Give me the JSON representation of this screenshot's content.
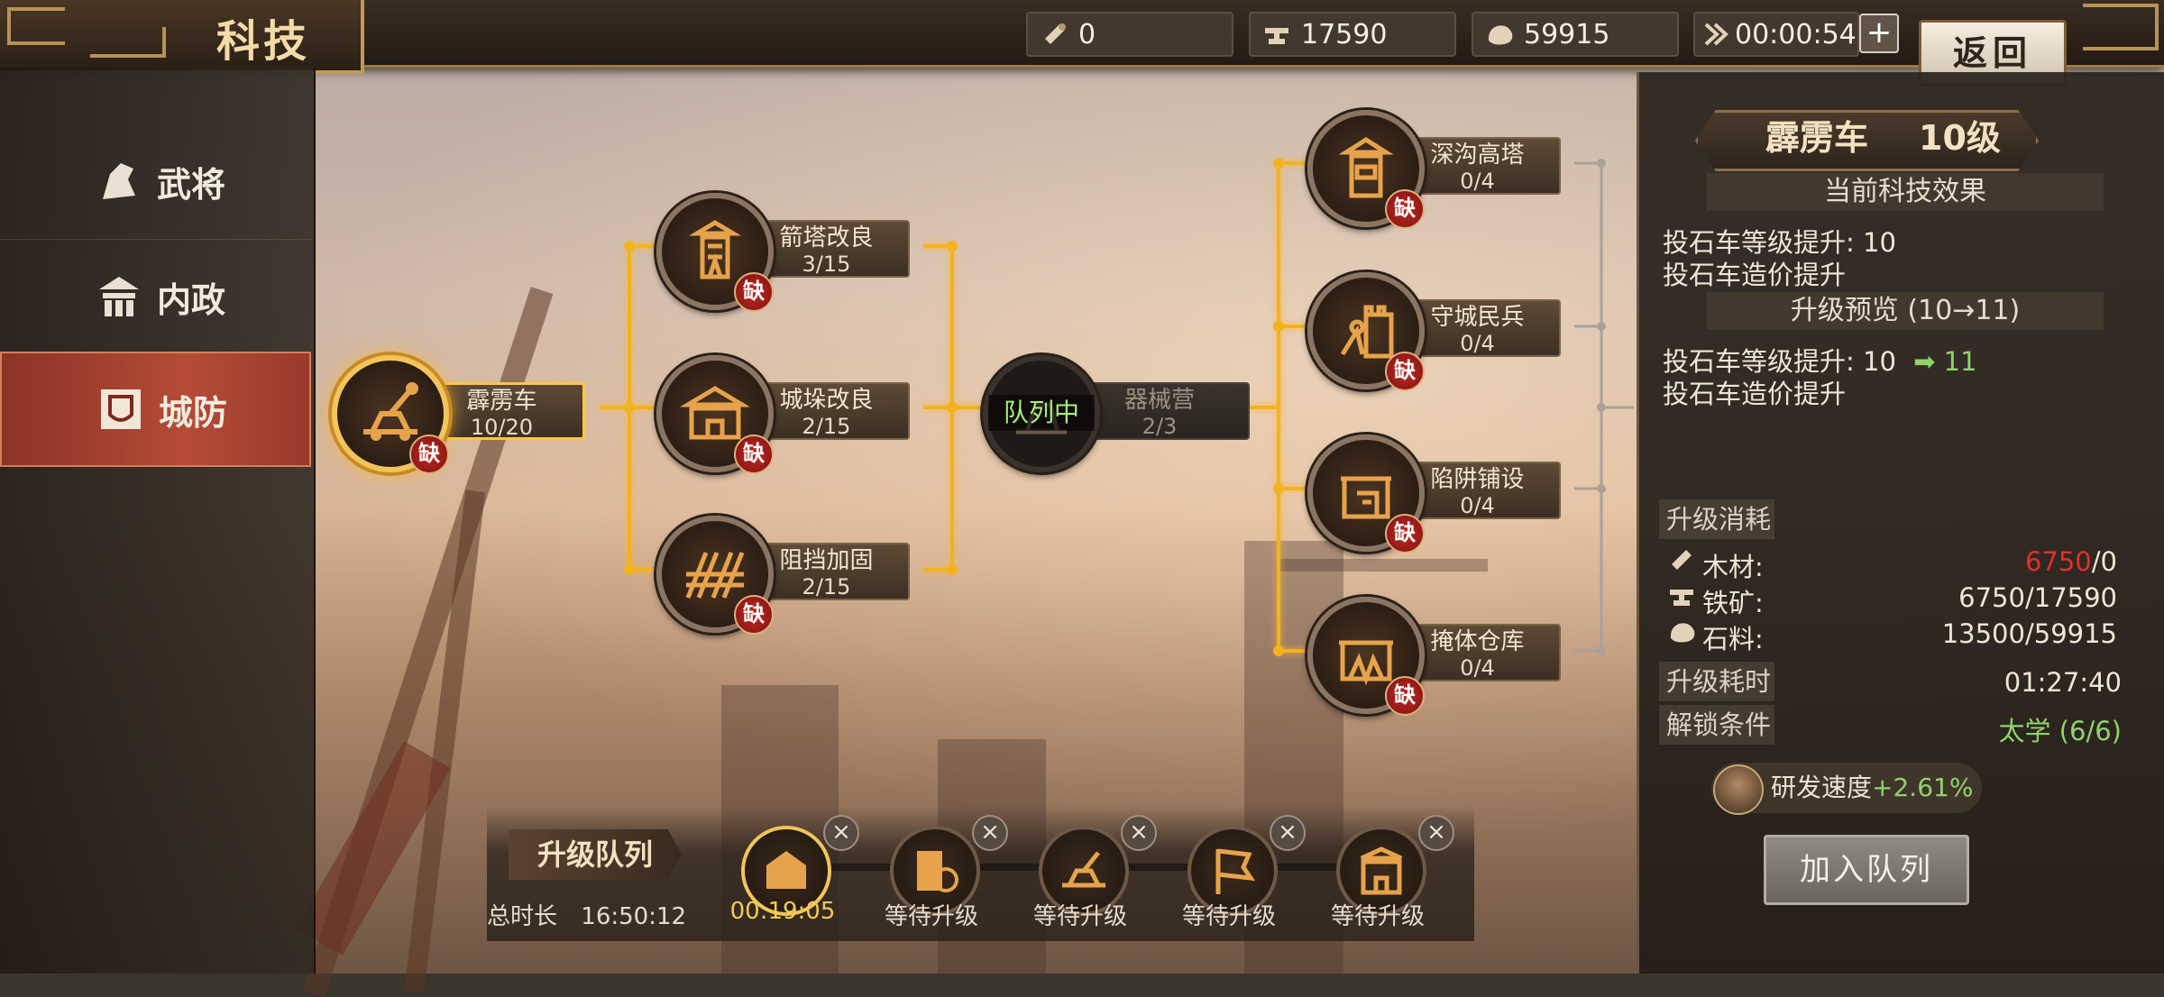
{
  "header": {
    "title": "科技",
    "back_label": "返回",
    "plus_label": "+",
    "resources": [
      {
        "icon": "wood-icon",
        "value": "0"
      },
      {
        "icon": "iron-icon",
        "value": "17590"
      },
      {
        "icon": "stone-icon",
        "value": "59915"
      },
      {
        "icon": "speedup-icon",
        "value": "00:00:54"
      }
    ]
  },
  "nav": {
    "items": [
      {
        "label": "武将",
        "icon": "general-icon",
        "active": false
      },
      {
        "label": "内政",
        "icon": "civil-icon",
        "active": false
      },
      {
        "label": "城防",
        "icon": "defense-icon",
        "active": true
      }
    ]
  },
  "tree": {
    "lack_label": "缺",
    "queue_tag": "队列中",
    "nodes": [
      {
        "name": "霹雳车",
        "level": "10/20",
        "icon": "catapult-icon",
        "selected": true,
        "lack": true
      },
      {
        "name": "箭塔改良",
        "level": "3/15",
        "icon": "arrow-tower-icon",
        "lack": true
      },
      {
        "name": "城垛改良",
        "level": "2/15",
        "icon": "battlement-icon",
        "lack": true
      },
      {
        "name": "阻挡加固",
        "level": "2/15",
        "icon": "barricade-icon",
        "lack": true
      },
      {
        "name": "器械营",
        "level": "2/3",
        "icon": "siege-camp-icon",
        "queued": true
      },
      {
        "name": "深沟高塔",
        "level": "0/4",
        "icon": "watchtower-icon",
        "lack": true
      },
      {
        "name": "守城民兵",
        "level": "0/4",
        "icon": "militia-icon",
        "lack": true
      },
      {
        "name": "陷阱铺设",
        "level": "0/4",
        "icon": "trap-icon",
        "lack": true
      },
      {
        "name": "掩体仓库",
        "level": "0/4",
        "icon": "bunker-icon",
        "lack": true
      }
    ]
  },
  "panel": {
    "title_name": "霹雳车",
    "title_level": "10级",
    "current_effect_header": "当前科技效果",
    "current_effects": [
      "投石车等级提升: 10",
      "投石车造价提升"
    ],
    "preview_header": "升级预览 (10→11)",
    "preview_line1_prefix": "投石车等级提升: 10",
    "preview_arrow": "➡",
    "preview_line1_next": "11",
    "preview_line2": "投石车造价提升",
    "cost_header": "升级消耗",
    "costs": [
      {
        "name": "木材:",
        "icon": "wood-icon",
        "need": "6750",
        "have": "/0",
        "insufficient": true
      },
      {
        "name": "铁矿:",
        "icon": "iron-icon",
        "need": "6750",
        "have": "/17590",
        "insufficient": false
      },
      {
        "name": "石料:",
        "icon": "stone-icon",
        "need": "13500",
        "have": "/59915",
        "insufficient": false
      }
    ],
    "time_label": "升级耗时",
    "time_value": "01:27:40",
    "unlock_label": "解锁条件",
    "unlock_value": "太学 (6/6)",
    "speed_label": "研发速度",
    "speed_value": "+2.61%",
    "join_label": "加入队列",
    "colors": {
      "insufficient": "#e0302a",
      "ok": "#8fd46a",
      "accent": "#f2c45a"
    }
  },
  "queue": {
    "label": "升级队列",
    "total_label": "总时长",
    "total_value": "16:50:12",
    "close_label": "×",
    "slots": [
      {
        "icon": "research-icon",
        "status": "00:19:05",
        "active": true
      },
      {
        "icon": "book-clock-icon",
        "status": "等待升级"
      },
      {
        "icon": "catapult-icon",
        "status": "等待升级"
      },
      {
        "icon": "banner-icon",
        "status": "等待升级"
      },
      {
        "icon": "gate-icon",
        "status": "等待升级"
      }
    ]
  }
}
